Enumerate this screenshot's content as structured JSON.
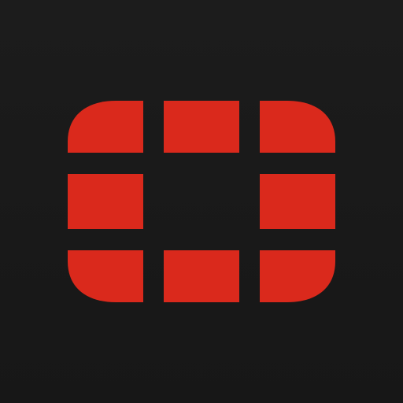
{
  "icon": {
    "name": "fortinet-app-icon",
    "background_color": "#1b1b1b",
    "logo_color": "#da291c",
    "logo_symbol": "fortinet-logo-icon"
  }
}
